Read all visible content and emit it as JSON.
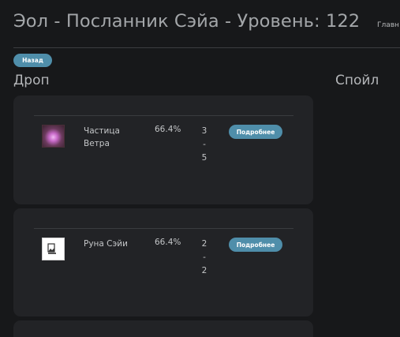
{
  "header": {
    "title": "Эол - Посланник Сэйа - Уровень: 122",
    "breadcrumb": "Главн"
  },
  "back_label": "Назад",
  "sections": {
    "drop": "Дроп",
    "spoil": "Спойл"
  },
  "drop_items": [
    {
      "icon": "wind-particle-icon",
      "name": "Частица Ветра",
      "chance": "66.4%",
      "qty_min": "3",
      "qty_sep": "-",
      "qty_max": "5",
      "details_label": "Подробнее"
    },
    {
      "icon": "broken-image-icon",
      "name": "Руна Сэйи",
      "chance": "66.4%",
      "qty_min": "2",
      "qty_sep": "-",
      "qty_max": "2",
      "details_label": "Подробнее"
    }
  ]
}
